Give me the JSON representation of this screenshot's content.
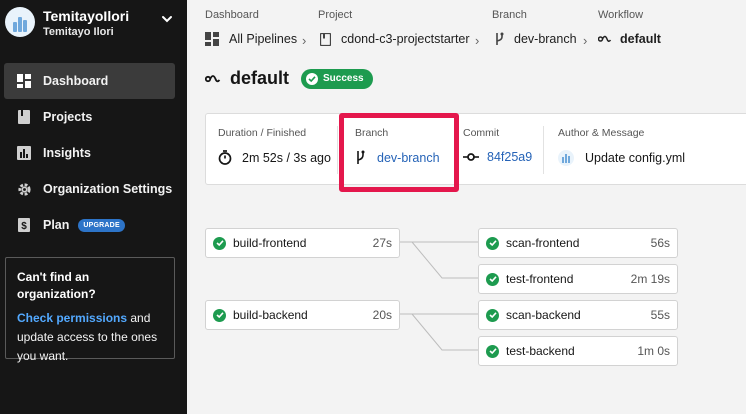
{
  "account": {
    "name": "TemitayoIlori",
    "display_name": "Temitayo Ilori"
  },
  "sidebar": {
    "items": [
      {
        "label": "Dashboard",
        "icon": "dashboard-icon",
        "active": true
      },
      {
        "label": "Projects",
        "icon": "book-icon"
      },
      {
        "label": "Insights",
        "icon": "bar-chart-icon"
      },
      {
        "label": "Organization Settings",
        "icon": "gear-icon"
      },
      {
        "label": "Plan",
        "icon": "dollar-icon",
        "badge": "UPGRADE"
      }
    ],
    "org_box": {
      "title": "Can't find an organization?",
      "link": "Check permissions",
      "text": " and update access to the ones you want."
    }
  },
  "breadcrumb": {
    "dashboard_label": "Dashboard",
    "dashboard_value": "All Pipelines",
    "project_label": "Project",
    "project_value": "cdond-c3-projectstarter",
    "branch_label": "Branch",
    "branch_value": "dev-branch",
    "workflow_label": "Workflow",
    "workflow_value": "default"
  },
  "workflow": {
    "title": "default",
    "status": "Success"
  },
  "info": {
    "duration_label": "Duration / Finished",
    "duration_value": "2m 52s / 3s ago",
    "branch_label": "Branch",
    "branch_value": "dev-branch",
    "commit_label": "Commit",
    "commit_value": "84f25a9",
    "author_label": "Author & Message",
    "author_value": "Update config.yml"
  },
  "jobs": [
    {
      "name": "build-frontend",
      "duration": "27s",
      "status": "success"
    },
    {
      "name": "scan-frontend",
      "duration": "56s",
      "status": "success"
    },
    {
      "name": "test-frontend",
      "duration": "2m 19s",
      "status": "success"
    },
    {
      "name": "build-backend",
      "duration": "20s",
      "status": "success"
    },
    {
      "name": "scan-backend",
      "duration": "55s",
      "status": "success"
    },
    {
      "name": "test-backend",
      "duration": "1m 0s",
      "status": "success"
    }
  ],
  "colors": {
    "success": "#1d9b4f",
    "link": "#2563b7",
    "highlight": "#e4174c",
    "sidebar_bg": "#161616",
    "upgrade_badge": "#2d74c8"
  }
}
